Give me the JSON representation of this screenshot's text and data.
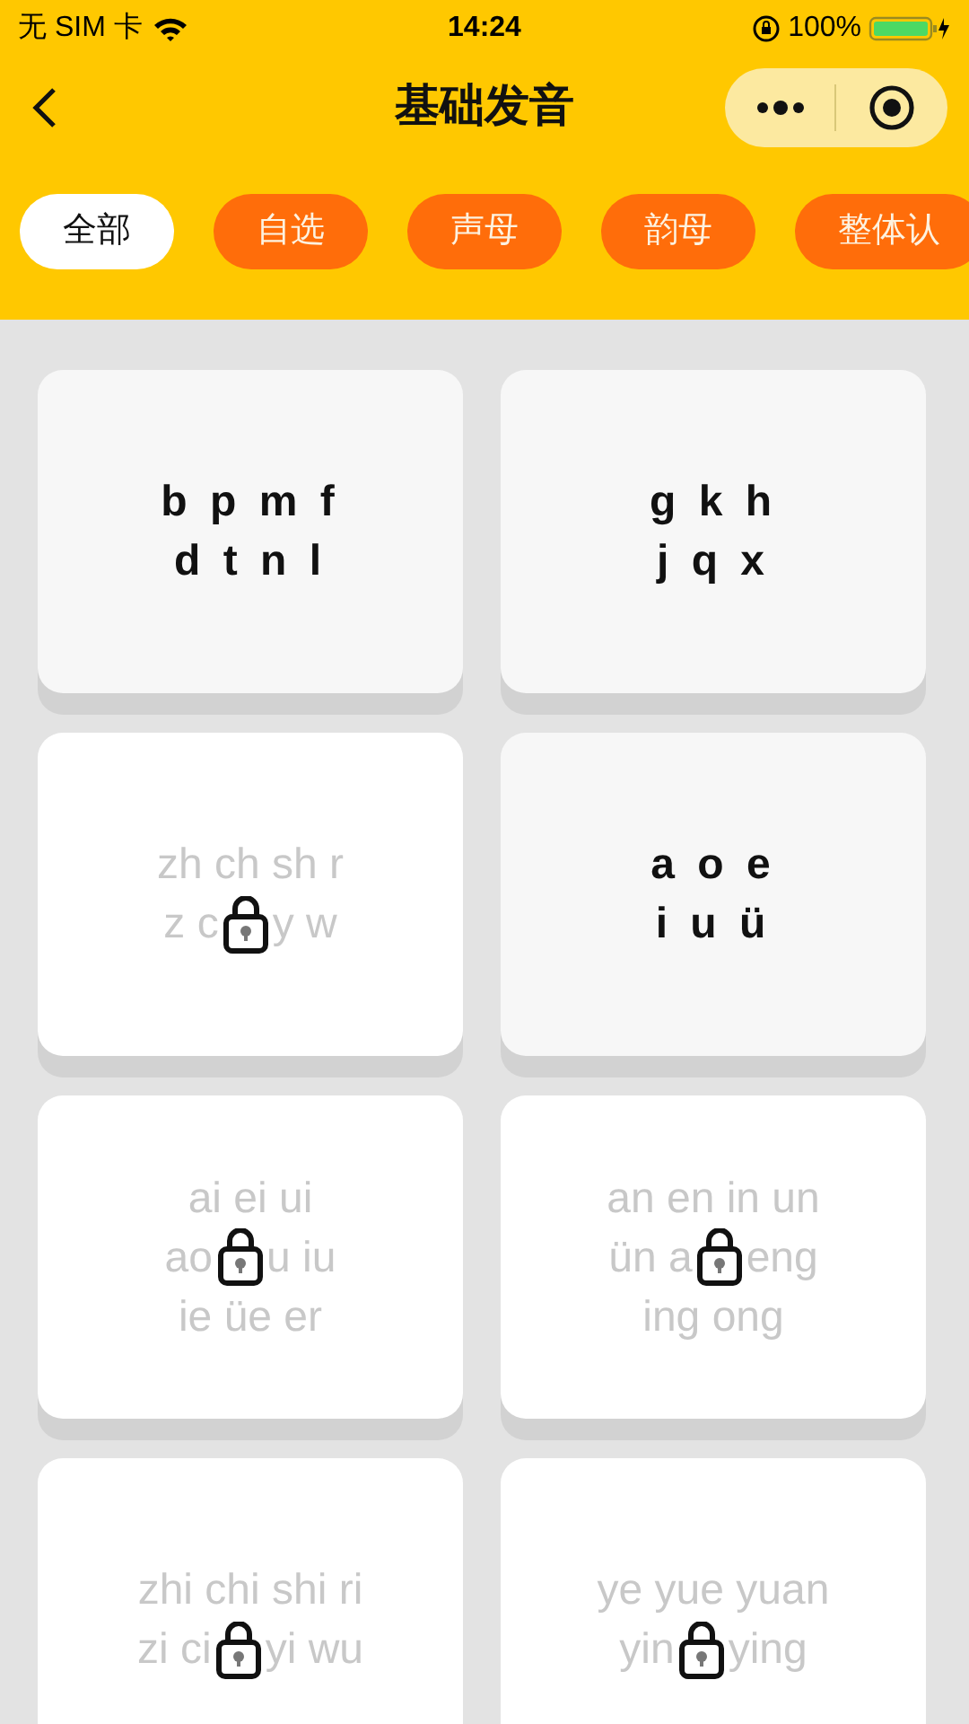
{
  "status_bar": {
    "carrier": "无 SIM 卡",
    "time": "14:24",
    "battery": "100%"
  },
  "nav": {
    "title": "基础发音"
  },
  "tabs": [
    {
      "label": "全部",
      "selected": true
    },
    {
      "label": "自选",
      "selected": false
    },
    {
      "label": "声母",
      "selected": false
    },
    {
      "label": "韵母",
      "selected": false
    },
    {
      "label": "整体认",
      "selected": false
    }
  ],
  "cards": [
    {
      "lines": [
        [
          "b p m f"
        ],
        [
          "d t n l"
        ]
      ],
      "locked": false
    },
    {
      "lines": [
        [
          "g k h"
        ],
        [
          "j q x"
        ]
      ],
      "locked": false
    },
    {
      "lines": [
        [
          "zh ch sh r"
        ],
        [
          "z c",
          "y w"
        ]
      ],
      "locked": true
    },
    {
      "lines": [
        [
          "a o e"
        ],
        [
          "i u ü"
        ]
      ],
      "locked": false
    },
    {
      "lines": [
        [
          "ai ei ui"
        ],
        [
          "ao",
          "u iu"
        ],
        [
          "ie üe er"
        ]
      ],
      "locked": true
    },
    {
      "lines": [
        [
          "an en in un"
        ],
        [
          "ün a",
          "eng"
        ],
        [
          "ing ong"
        ]
      ],
      "locked": true
    },
    {
      "lines": [
        [
          "zhi chi shi ri"
        ],
        [
          "zi ci",
          "yi wu"
        ]
      ],
      "locked": true
    },
    {
      "lines": [
        [
          "ye yue yuan"
        ],
        [
          "yin",
          "ying"
        ]
      ],
      "locked": true
    }
  ]
}
